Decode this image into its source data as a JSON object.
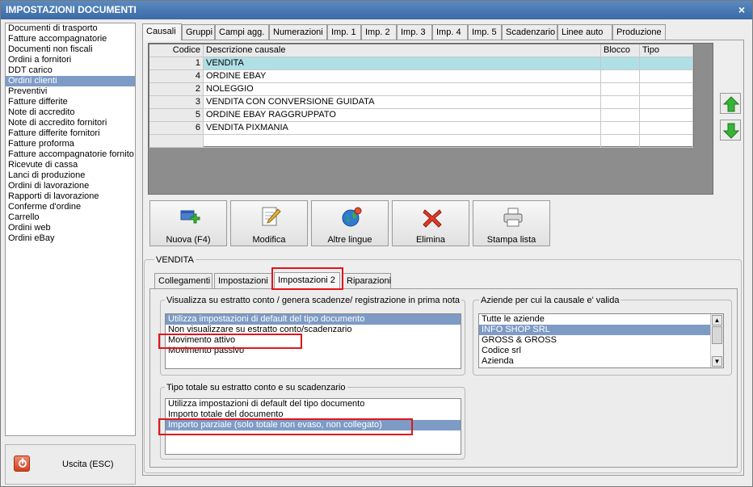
{
  "window": {
    "title": "IMPOSTAZIONI DOCUMENTI",
    "close": "×"
  },
  "doc_list": [
    "Documenti di trasporto",
    "Fatture accompagnatorie",
    "Documenti non fiscali",
    "Ordini a fornitori",
    "DDT carico",
    "Ordini clienti",
    "Preventivi",
    "Fatture differite",
    "Note di accredito",
    "Note di accredito fornitori",
    "Fatture differite fornitori",
    "Fatture proforma",
    "Fatture accompagnatorie fornito",
    "Ricevute di cassa",
    "Lanci di produzione",
    "Ordini di lavorazione",
    "Rapporti di lavorazione",
    "Conferme d'ordine",
    "Carrello",
    "Ordini web",
    "Ordini eBay"
  ],
  "doc_list_selected": "Ordini clienti",
  "exit_button": "Uscita (ESC)",
  "tabs": [
    "Causali",
    "Gruppi",
    "Campi agg.",
    "Numerazioni",
    "Imp. 1",
    "Imp. 2",
    "Imp. 3",
    "Imp. 4",
    "Imp. 5",
    "Scadenzario",
    "Linee auto",
    "Produzione"
  ],
  "active_tab": "Causali",
  "grid": {
    "headers": [
      "Codice",
      "Descrizione causale",
      "Blocco",
      "Tipo"
    ],
    "rows": [
      {
        "code": "1",
        "desc": "VENDITA",
        "blocco": "",
        "tipo": ""
      },
      {
        "code": "4",
        "desc": "ORDINE EBAY",
        "blocco": "",
        "tipo": ""
      },
      {
        "code": "2",
        "desc": "NOLEGGIO",
        "blocco": "",
        "tipo": ""
      },
      {
        "code": "3",
        "desc": "VENDITA CON CONVERSIONE GUIDATA",
        "blocco": "",
        "tipo": ""
      },
      {
        "code": "5",
        "desc": "ORDINE EBAY RAGGRUPPATO",
        "blocco": "",
        "tipo": ""
      },
      {
        "code": "6",
        "desc": "VENDITA PIXMANIA",
        "blocco": "",
        "tipo": ""
      }
    ]
  },
  "toolbar": {
    "new": "Nuova (F4)",
    "edit": "Modifica",
    "languages": "Altre lingue",
    "delete": "Elimina",
    "print": "Stampa lista"
  },
  "group_title": "VENDITA",
  "subtabs": [
    "Collegamenti",
    "Impostazioni",
    "Impostazioni 2",
    "Riparazioni"
  ],
  "active_subtab": "Impostazioni 2",
  "statement": {
    "label": "Visualizza su estratto conto / genera scadenze/ registrazione  in prima nota",
    "options": [
      "Utilizza impostazioni di default del tipo documento",
      "Non visualizzare su estratto conto/scadenzario",
      "Movimento attivo",
      "Movimento passivo"
    ],
    "selected": "Utilizza impostazioni di default del tipo documento"
  },
  "companies": {
    "label": "Aziende per cui la causale e' valida",
    "options": [
      "Tutte le aziende",
      "INFO SHOP SRL",
      "GROSS & GROSS",
      "Codice srl",
      "Azienda"
    ],
    "selected": "INFO SHOP SRL"
  },
  "total_type": {
    "label": "Tipo totale su estratto conto e su scadenzario",
    "options": [
      "Utilizza impostazioni di default del tipo documento",
      "Importo totale del documento",
      "Importo parziale (solo totale non evaso, non collegato)"
    ],
    "selected": "Importo parziale (solo totale non evaso, non collegato)"
  },
  "colors": {
    "selection": "#7d9bc5",
    "highlight_row": "#aee0e6",
    "annotation": "#e0161a",
    "titlebar": "#3b6aa6"
  }
}
